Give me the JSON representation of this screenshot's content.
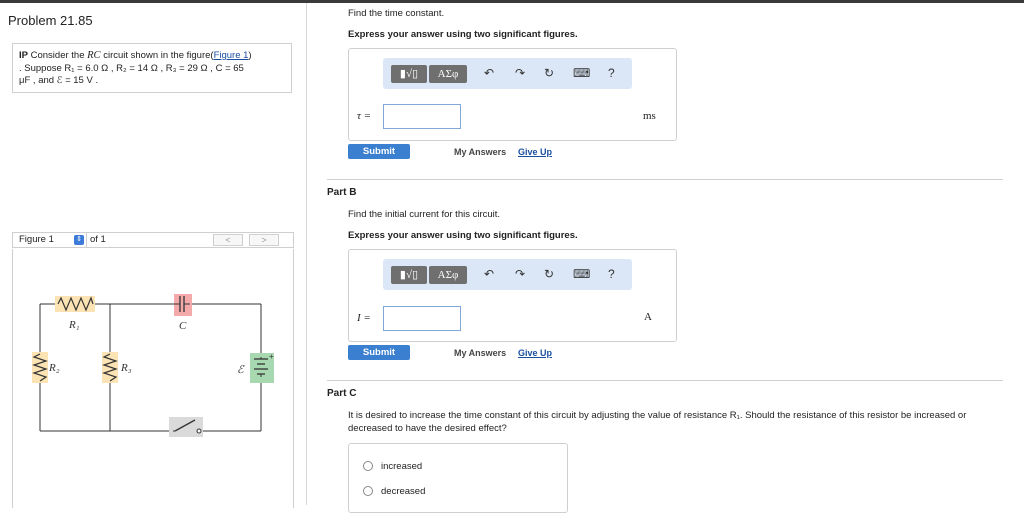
{
  "problem": {
    "title": "Problem 21.85"
  },
  "intro": {
    "prefix": "IP",
    "text1": "Consider the",
    "rc": "RC",
    "text2": "circuit shown in the figure(",
    "figure_link": "Figure 1",
    "text3": ")",
    "line2": ". Suppose R₁ = 6.0 Ω , R₂ = 14 Ω , R₃ = 29 Ω , C = 65",
    "line3": "μF , and ℰ = 15 V ."
  },
  "figure_bar": {
    "selected": "Figure 1",
    "of": "of 1",
    "prev": "<",
    "next": ">"
  },
  "circuit": {
    "r1": "R₁",
    "r2": "R₂",
    "r3": "R₃",
    "c": "C",
    "emf": "ℰ",
    "plus": "+"
  },
  "part_a": {
    "question": "Find the time constant.",
    "instruction": "Express your answer using two significant figures.",
    "var": "τ =",
    "value": "",
    "unit": "ms"
  },
  "part_b": {
    "label": "Part B",
    "question": "Find the initial current for this circuit.",
    "instruction": "Express your answer using two significant figures.",
    "var": "I =",
    "value": "",
    "unit": "A"
  },
  "toolbar": {
    "templates": "▮√▯",
    "greek": "ΑΣφ",
    "undo": "↶",
    "redo": "↷",
    "reset": "↻",
    "keyboard": "⌨",
    "help": "?"
  },
  "actions": {
    "submit": "Submit",
    "my_answers": "My Answers",
    "give_up": "Give Up"
  },
  "part_c": {
    "label": "Part C",
    "question": "It is desired to increase the time constant of this circuit by adjusting the value of resistance R₁. Should the resistance of this resistor be increased or decreased to have the desired effect?",
    "options": [
      "increased",
      "decreased"
    ]
  }
}
